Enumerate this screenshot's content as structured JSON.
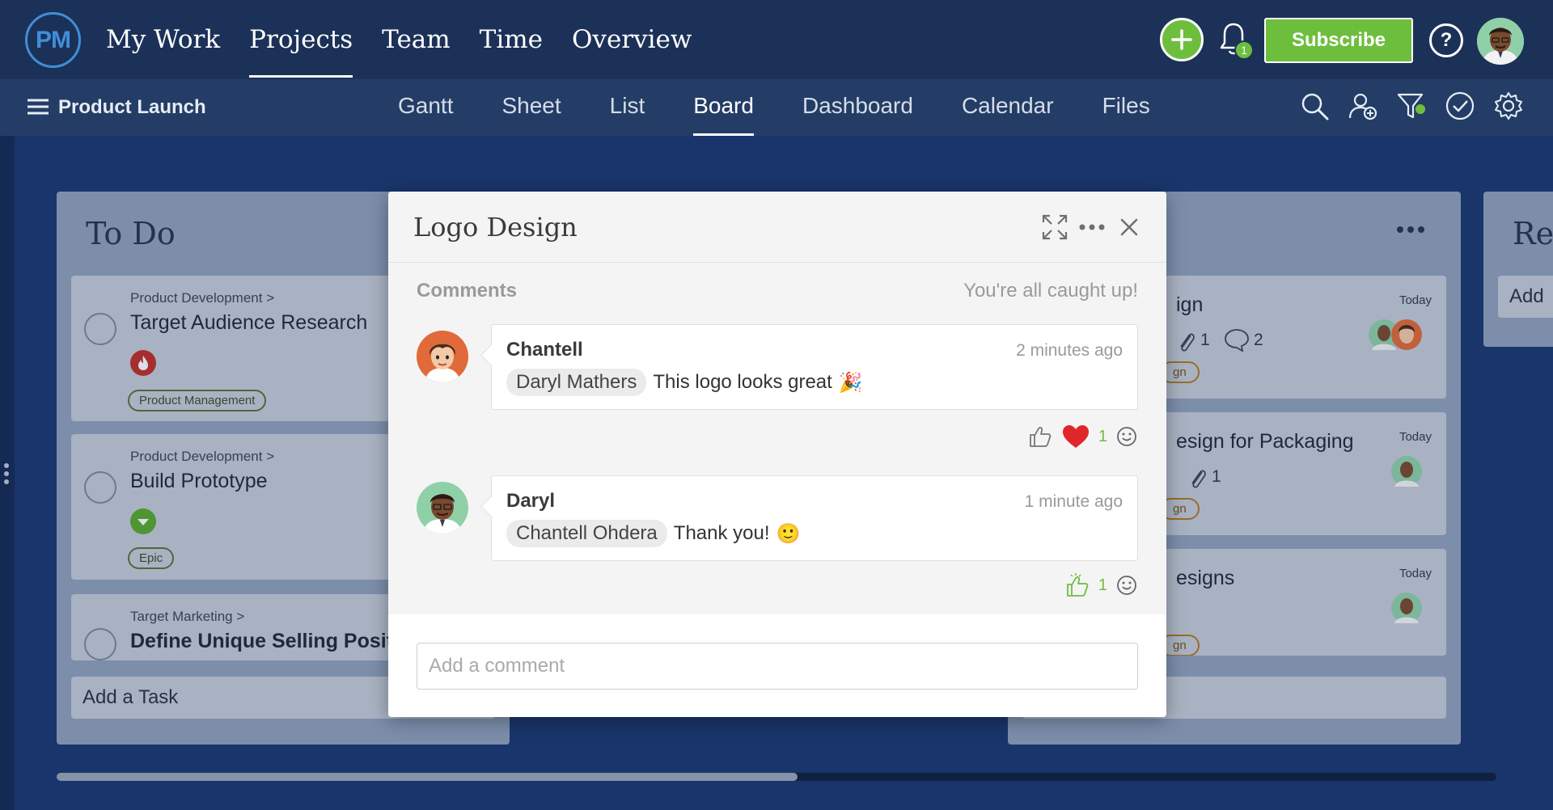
{
  "app": {
    "logo_text": "PM",
    "main_nav": [
      "My Work",
      "Projects",
      "Team",
      "Time",
      "Overview"
    ],
    "active_main_nav": "Projects",
    "notifications_count": "1",
    "subscribe_label": "Subscribe",
    "help_label": "?"
  },
  "project": {
    "name": "Product Launch",
    "views": [
      "Gantt",
      "Sheet",
      "List",
      "Board",
      "Dashboard",
      "Calendar",
      "Files"
    ],
    "active_view": "Board"
  },
  "board": {
    "todo": {
      "title": "To Do",
      "cards": [
        {
          "crumb": "Product Development >",
          "title": "Target Audience Research",
          "tag": "Product Management",
          "priority_icon": "flame-icon"
        },
        {
          "crumb": "Product Development >",
          "title": "Build Prototype",
          "tag": "Epic",
          "priority_icon": "chevron-down-icon"
        },
        {
          "crumb": "Target Marketing >",
          "title": "Define Unique Selling Positi"
        }
      ],
      "add_task_label": "Add a Task"
    },
    "right_column": {
      "cards": [
        {
          "title_fragment": "ign",
          "due": "Today",
          "attachments": "1",
          "comments": "2",
          "tag_fragment": "gn"
        },
        {
          "title_fragment": "esign for Packaging",
          "due": "Today",
          "attachments": "1",
          "tag_fragment": "gn"
        },
        {
          "title_fragment": "esigns",
          "due": "Today",
          "tag_fragment": "gn"
        }
      ]
    },
    "far_column": {
      "title_fragment": "Re",
      "add_fragment": "Add"
    }
  },
  "modal": {
    "title": "Logo Design",
    "comments_label": "Comments",
    "status_text": "You're all caught up!",
    "comments": [
      {
        "author": "Chantell",
        "time": "2 minutes ago",
        "mention": "Daryl Mathers",
        "text": "This logo looks great",
        "emoji": "🎉",
        "reactions": {
          "heart_count": "1"
        }
      },
      {
        "author": "Daryl",
        "time": "1 minute ago",
        "mention": "Chantell  Ohdera",
        "text": "Thank you!",
        "emoji": "🙂",
        "reactions": {
          "like_count": "1"
        }
      }
    ],
    "add_comment_placeholder": "Add a comment"
  },
  "colors": {
    "accent_green": "#6ebe3e",
    "nav_bg": "#1c3158",
    "board_bg": "#1b3870",
    "heart_red": "#e0262b"
  }
}
